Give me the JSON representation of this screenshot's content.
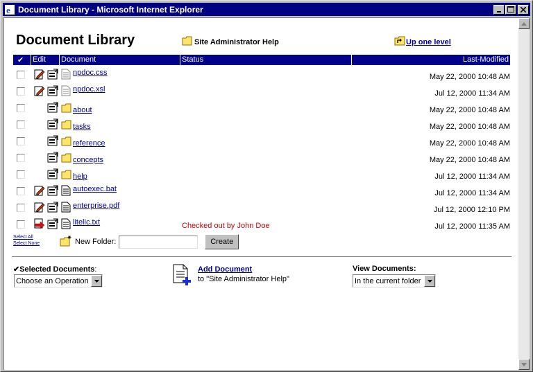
{
  "window": {
    "title": "Document Library - Microsoft Internet Explorer",
    "icon": "ie-icon"
  },
  "page": {
    "title": "Document Library",
    "help_link": "Site Administrator Help",
    "up_link": "Up one level"
  },
  "table": {
    "columns": [
      "Edit",
      "Document",
      "Status",
      "Last-Modified"
    ],
    "rows": [
      {
        "name": "npdoc.css",
        "type": "file-gray",
        "edit": true,
        "status": "",
        "modified": "May 22, 2000 10:48 AM"
      },
      {
        "name": "npdoc.xsl",
        "type": "file-gray",
        "edit": true,
        "status": "",
        "modified": "Jul 12, 2000 11:34 AM"
      },
      {
        "name": "about",
        "type": "folder",
        "edit": false,
        "status": "",
        "modified": "May 22, 2000 10:48 AM"
      },
      {
        "name": "tasks",
        "type": "folder",
        "edit": false,
        "status": "",
        "modified": "May 22, 2000 10:48 AM"
      },
      {
        "name": "reference",
        "type": "folder",
        "edit": false,
        "status": "",
        "modified": "May 22, 2000 10:48 AM"
      },
      {
        "name": "concepts",
        "type": "folder",
        "edit": false,
        "status": "",
        "modified": "May 22, 2000 10:48 AM"
      },
      {
        "name": "help",
        "type": "folder",
        "edit": false,
        "status": "",
        "modified": "Jul 12, 2000 11:34 AM"
      },
      {
        "name": "autoexec.bat",
        "type": "file",
        "edit": true,
        "status": "",
        "modified": "Jul 12, 2000 11:34 AM"
      },
      {
        "name": "enterprise.pdf",
        "type": "file",
        "edit": true,
        "status": "",
        "modified": "Jul 12, 2000 12:10 PM"
      },
      {
        "name": "litelic.txt",
        "type": "file",
        "edit": "checkedout",
        "status": "Checked out by John Doe",
        "modified": "Jul 12, 2000 11:35 AM"
      }
    ]
  },
  "select_all": "Select All",
  "select_none": "Select None",
  "new_folder_label": "New Folder:",
  "create_button": "Create",
  "selected_docs_label": "Selected Documents",
  "selected_docs_colon": ":",
  "operation_select": "Choose an Operation",
  "add_document": "Add Document",
  "add_document_to": "to \"Site Administrator Help\"",
  "view_docs_label": "View Documents:",
  "view_select": "In the current folder",
  "colors": {
    "header": "#00008b",
    "titlebar": "#000080",
    "status": "#cc0000"
  }
}
